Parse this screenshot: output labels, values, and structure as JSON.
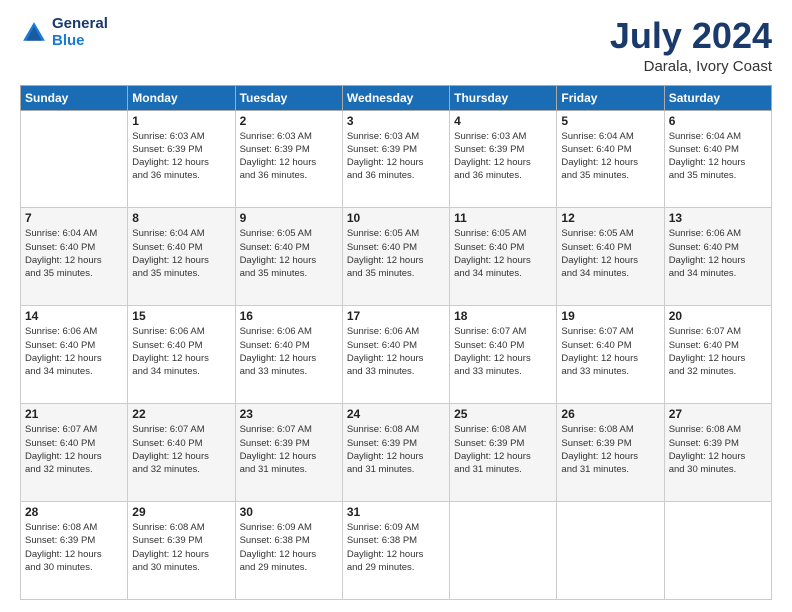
{
  "header": {
    "logo_line1": "General",
    "logo_line2": "Blue",
    "month_year": "July 2024",
    "location": "Darala, Ivory Coast"
  },
  "days_of_week": [
    "Sunday",
    "Monday",
    "Tuesday",
    "Wednesday",
    "Thursday",
    "Friday",
    "Saturday"
  ],
  "weeks": [
    [
      {
        "day": null
      },
      {
        "day": "1",
        "sunrise": "6:03 AM",
        "sunset": "6:39 PM",
        "daylight": "12 hours and 36 minutes."
      },
      {
        "day": "2",
        "sunrise": "6:03 AM",
        "sunset": "6:39 PM",
        "daylight": "12 hours and 36 minutes."
      },
      {
        "day": "3",
        "sunrise": "6:03 AM",
        "sunset": "6:39 PM",
        "daylight": "12 hours and 36 minutes."
      },
      {
        "day": "4",
        "sunrise": "6:03 AM",
        "sunset": "6:39 PM",
        "daylight": "12 hours and 36 minutes."
      },
      {
        "day": "5",
        "sunrise": "6:04 AM",
        "sunset": "6:40 PM",
        "daylight": "12 hours and 35 minutes."
      },
      {
        "day": "6",
        "sunrise": "6:04 AM",
        "sunset": "6:40 PM",
        "daylight": "12 hours and 35 minutes."
      }
    ],
    [
      {
        "day": "7",
        "sunrise": "6:04 AM",
        "sunset": "6:40 PM",
        "daylight": "12 hours and 35 minutes."
      },
      {
        "day": "8",
        "sunrise": "6:04 AM",
        "sunset": "6:40 PM",
        "daylight": "12 hours and 35 minutes."
      },
      {
        "day": "9",
        "sunrise": "6:05 AM",
        "sunset": "6:40 PM",
        "daylight": "12 hours and 35 minutes."
      },
      {
        "day": "10",
        "sunrise": "6:05 AM",
        "sunset": "6:40 PM",
        "daylight": "12 hours and 35 minutes."
      },
      {
        "day": "11",
        "sunrise": "6:05 AM",
        "sunset": "6:40 PM",
        "daylight": "12 hours and 34 minutes."
      },
      {
        "day": "12",
        "sunrise": "6:05 AM",
        "sunset": "6:40 PM",
        "daylight": "12 hours and 34 minutes."
      },
      {
        "day": "13",
        "sunrise": "6:06 AM",
        "sunset": "6:40 PM",
        "daylight": "12 hours and 34 minutes."
      }
    ],
    [
      {
        "day": "14",
        "sunrise": "6:06 AM",
        "sunset": "6:40 PM",
        "daylight": "12 hours and 34 minutes."
      },
      {
        "day": "15",
        "sunrise": "6:06 AM",
        "sunset": "6:40 PM",
        "daylight": "12 hours and 34 minutes."
      },
      {
        "day": "16",
        "sunrise": "6:06 AM",
        "sunset": "6:40 PM",
        "daylight": "12 hours and 33 minutes."
      },
      {
        "day": "17",
        "sunrise": "6:06 AM",
        "sunset": "6:40 PM",
        "daylight": "12 hours and 33 minutes."
      },
      {
        "day": "18",
        "sunrise": "6:07 AM",
        "sunset": "6:40 PM",
        "daylight": "12 hours and 33 minutes."
      },
      {
        "day": "19",
        "sunrise": "6:07 AM",
        "sunset": "6:40 PM",
        "daylight": "12 hours and 33 minutes."
      },
      {
        "day": "20",
        "sunrise": "6:07 AM",
        "sunset": "6:40 PM",
        "daylight": "12 hours and 32 minutes."
      }
    ],
    [
      {
        "day": "21",
        "sunrise": "6:07 AM",
        "sunset": "6:40 PM",
        "daylight": "12 hours and 32 minutes."
      },
      {
        "day": "22",
        "sunrise": "6:07 AM",
        "sunset": "6:40 PM",
        "daylight": "12 hours and 32 minutes."
      },
      {
        "day": "23",
        "sunrise": "6:07 AM",
        "sunset": "6:39 PM",
        "daylight": "12 hours and 31 minutes."
      },
      {
        "day": "24",
        "sunrise": "6:08 AM",
        "sunset": "6:39 PM",
        "daylight": "12 hours and 31 minutes."
      },
      {
        "day": "25",
        "sunrise": "6:08 AM",
        "sunset": "6:39 PM",
        "daylight": "12 hours and 31 minutes."
      },
      {
        "day": "26",
        "sunrise": "6:08 AM",
        "sunset": "6:39 PM",
        "daylight": "12 hours and 31 minutes."
      },
      {
        "day": "27",
        "sunrise": "6:08 AM",
        "sunset": "6:39 PM",
        "daylight": "12 hours and 30 minutes."
      }
    ],
    [
      {
        "day": "28",
        "sunrise": "6:08 AM",
        "sunset": "6:39 PM",
        "daylight": "12 hours and 30 minutes."
      },
      {
        "day": "29",
        "sunrise": "6:08 AM",
        "sunset": "6:39 PM",
        "daylight": "12 hours and 30 minutes."
      },
      {
        "day": "30",
        "sunrise": "6:09 AM",
        "sunset": "6:38 PM",
        "daylight": "12 hours and 29 minutes."
      },
      {
        "day": "31",
        "sunrise": "6:09 AM",
        "sunset": "6:38 PM",
        "daylight": "12 hours and 29 minutes."
      },
      {
        "day": null
      },
      {
        "day": null
      },
      {
        "day": null
      }
    ]
  ],
  "labels": {
    "sunrise_prefix": "Sunrise: ",
    "sunset_prefix": "Sunset: ",
    "daylight_prefix": "Daylight: "
  }
}
